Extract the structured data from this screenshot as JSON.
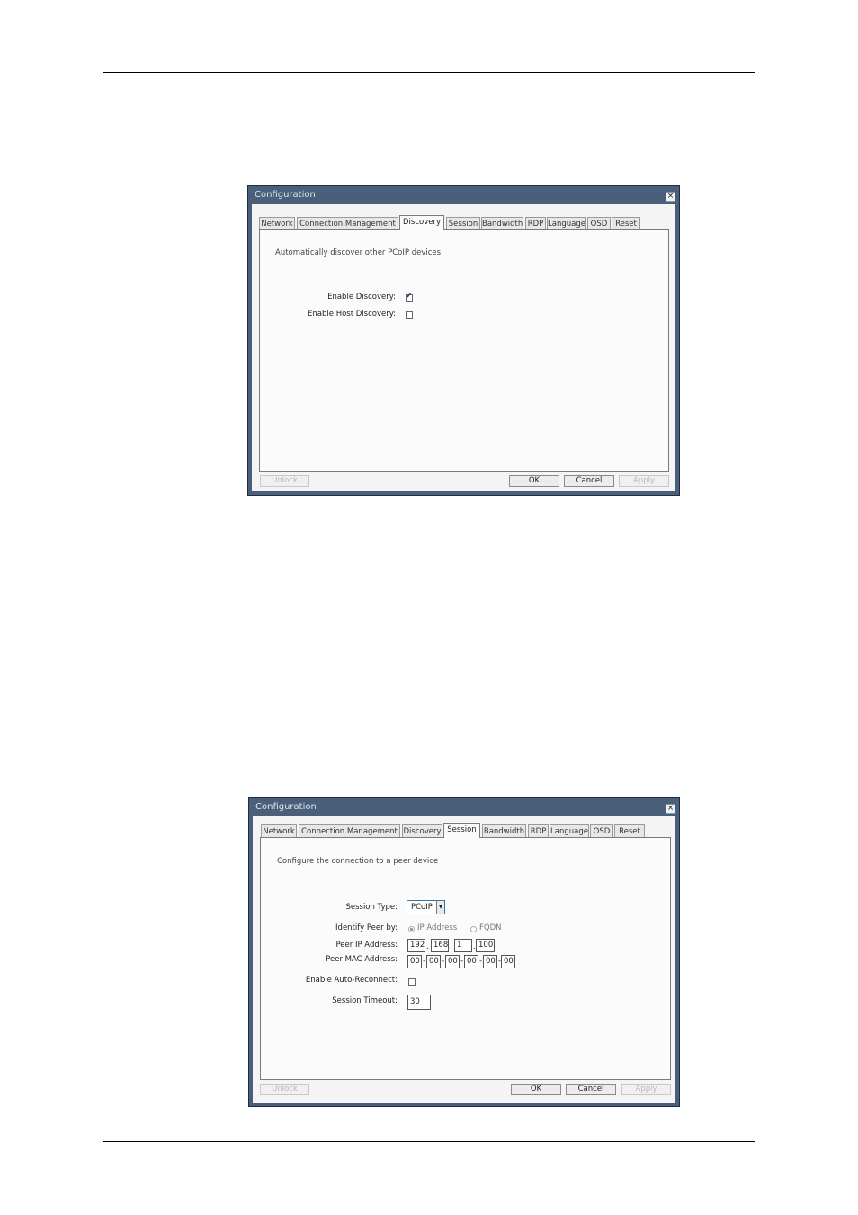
{
  "dialog1": {
    "title": "Configuration",
    "close_glyph": "×",
    "tabs": [
      "Network",
      "Connection Management",
      "Discovery",
      "Session",
      "Bandwidth",
      "RDP",
      "Language",
      "OSD",
      "Reset"
    ],
    "active_tab": "Discovery",
    "description": "Automatically discover other PCoIP devices",
    "enable_discovery": {
      "label": "Enable Discovery:",
      "checked": true
    },
    "enable_host_discovery": {
      "label": "Enable Host Discovery:",
      "checked": false
    },
    "buttons": {
      "unlock": "Unlock",
      "ok": "OK",
      "cancel": "Cancel",
      "apply": "Apply"
    }
  },
  "dialog2": {
    "title": "Configuration",
    "close_glyph": "×",
    "tabs": [
      "Network",
      "Connection Management",
      "Discovery",
      "Session",
      "Bandwidth",
      "RDP",
      "Language",
      "OSD",
      "Reset"
    ],
    "active_tab": "Session",
    "description": "Configure the connection to a peer device",
    "session_type": {
      "label": "Session Type:",
      "value": "PCoIP"
    },
    "identify_peer": {
      "label": "Identify Peer by:",
      "options": [
        "IP Address",
        "FQDN"
      ],
      "selected": "IP Address"
    },
    "peer_ip": {
      "label": "Peer IP Address:",
      "octets": [
        "192",
        "168",
        "1",
        "100"
      ],
      "separator": "."
    },
    "peer_mac": {
      "label": "Peer MAC Address:",
      "bytes": [
        "00",
        "00",
        "00",
        "00",
        "00",
        "00"
      ],
      "separator": "-"
    },
    "auto_reconnect": {
      "label": "Enable Auto-Reconnect:",
      "checked": false
    },
    "session_timeout": {
      "label": "Session Timeout:",
      "value": "30"
    },
    "buttons": {
      "unlock": "Unlock",
      "ok": "OK",
      "cancel": "Cancel",
      "apply": "Apply"
    }
  },
  "icons": {
    "checkbox_checked": "check-icon",
    "select_arrow": "chevron-down-icon",
    "close": "close-icon"
  },
  "colors": {
    "title_bar": "#4a5f7a",
    "select_border": "#3a6f99",
    "check": "#1f3a7a"
  }
}
